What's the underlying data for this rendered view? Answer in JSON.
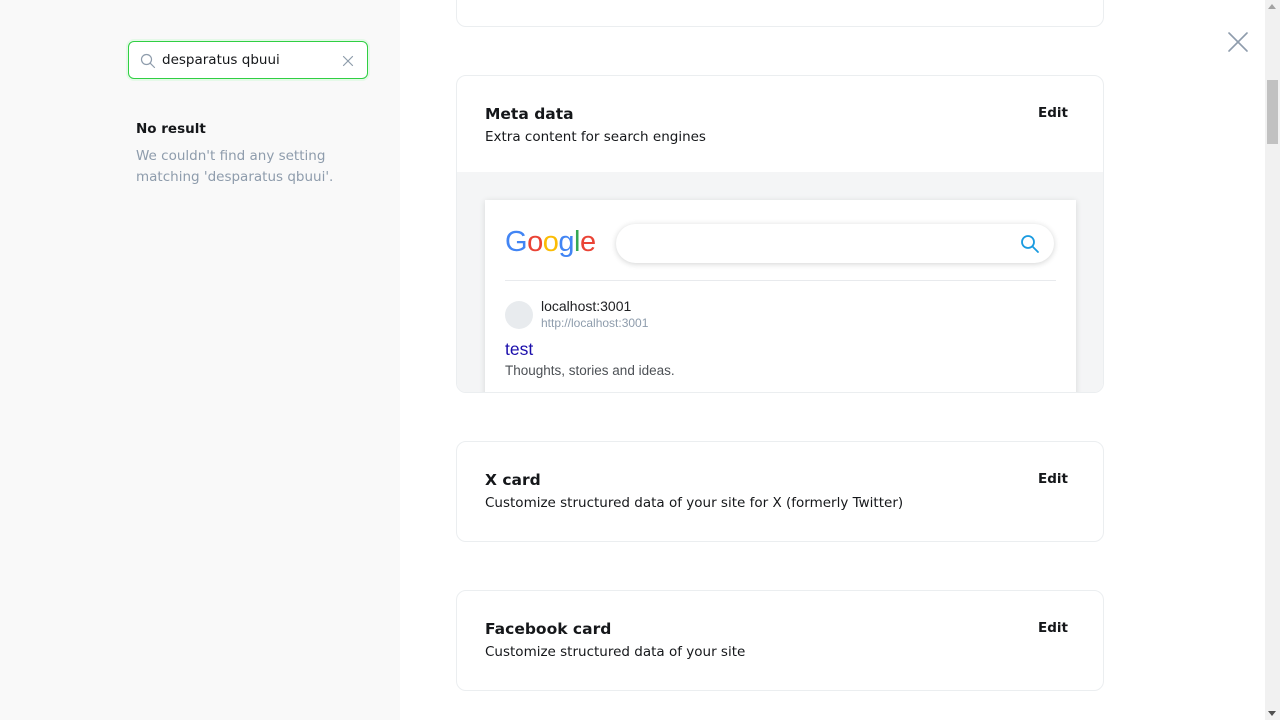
{
  "search": {
    "value": "desparatus qbuui",
    "accent_color": "#30cf43"
  },
  "no_result": {
    "title": "No result",
    "message": "We couldn't find any setting matching 'desparatus qbuui'."
  },
  "meta_data": {
    "title": "Meta data",
    "description": "Extra content for search engines",
    "edit_label": "Edit",
    "preview": {
      "logo_letters": [
        "G",
        "o",
        "o",
        "g",
        "l",
        "e"
      ],
      "logo_colors": [
        "#4285f4",
        "#ea4335",
        "#fbbc05",
        "#4285f4",
        "#34a853",
        "#ea4335"
      ],
      "site_name": "localhost:3001",
      "site_url": "http://localhost:3001",
      "result_title": "test",
      "result_description": "Thoughts, stories and ideas."
    }
  },
  "x_card": {
    "title": "X card",
    "description": "Customize structured data of your site for X (formerly Twitter)",
    "edit_label": "Edit"
  },
  "facebook_card": {
    "title": "Facebook card",
    "description": "Customize structured data of your site",
    "edit_label": "Edit"
  }
}
